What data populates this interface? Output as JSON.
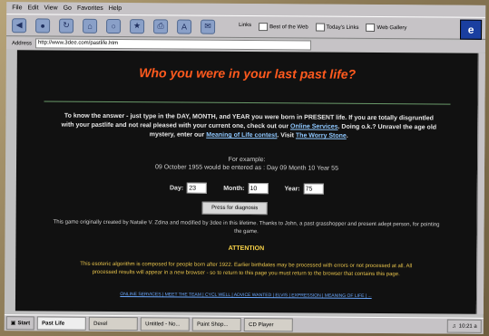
{
  "menubar": {
    "items": [
      "File",
      "Edit",
      "View",
      "Go",
      "Favorites",
      "Help"
    ]
  },
  "toolbar": {
    "links_label": "Links",
    "links": [
      "Best of the Web",
      "Today's Links",
      "Web Gallery"
    ],
    "ie_logo": "e"
  },
  "address": {
    "label": "Address",
    "url": "http://www.3dee.com/pastlife.htm"
  },
  "page": {
    "title": "Who you were in your last past life?",
    "intro_text": "To know the answer - just type in the DAY, MONTH, and YEAR you were born in PRESENT life. If you are totally disgruntled with your pastlife and not real pleased with your current one, check out our",
    "link_online_services": "Online Services",
    "intro_text2": ". Doing o.k.? Unravel the age old mystery, enter our",
    "link_meaning": "Meaning of Life contest",
    "intro_text3": ". Visit",
    "link_worry": "The Worry Stone",
    "intro_text4": ".",
    "example_heading": "For example:",
    "example_text": "09 October 1955 would be entered as : Day 09 Month 10 Year 55",
    "day_label": "Day:",
    "day_value": "23",
    "month_label": "Month:",
    "month_value": "10",
    "year_label": "Year:",
    "year_value": "75",
    "submit_label": "Press for diagnosis",
    "credit_text": "This game originally created by Natalie V. Zdina and modified by 3dee in this lifetime. Thanks to John, a past grasshopper and present adept person, for pointing the game.",
    "attention": "ATTENTION",
    "warning_text": "This esoteric algorithm is composed for people born after 1922. Earlier birthdates may be processed with errors or not processed at all. All processed results will appear in a new browser - so to return to this page you must return to the browser that contains this page.",
    "footer_links": "ONLINE SERVICES | MEET THE TEAM | CYCL WELL | ADVICE WANTED | ELVIS | EXPRESSION | MEANING OF LIFE | ..."
  },
  "taskbar": {
    "start": "Start",
    "tasks": [
      "Past Life",
      "Dexel",
      "Untitled - No...",
      "Paint Shop...",
      "CD Player"
    ],
    "clock": "10:21 a"
  }
}
